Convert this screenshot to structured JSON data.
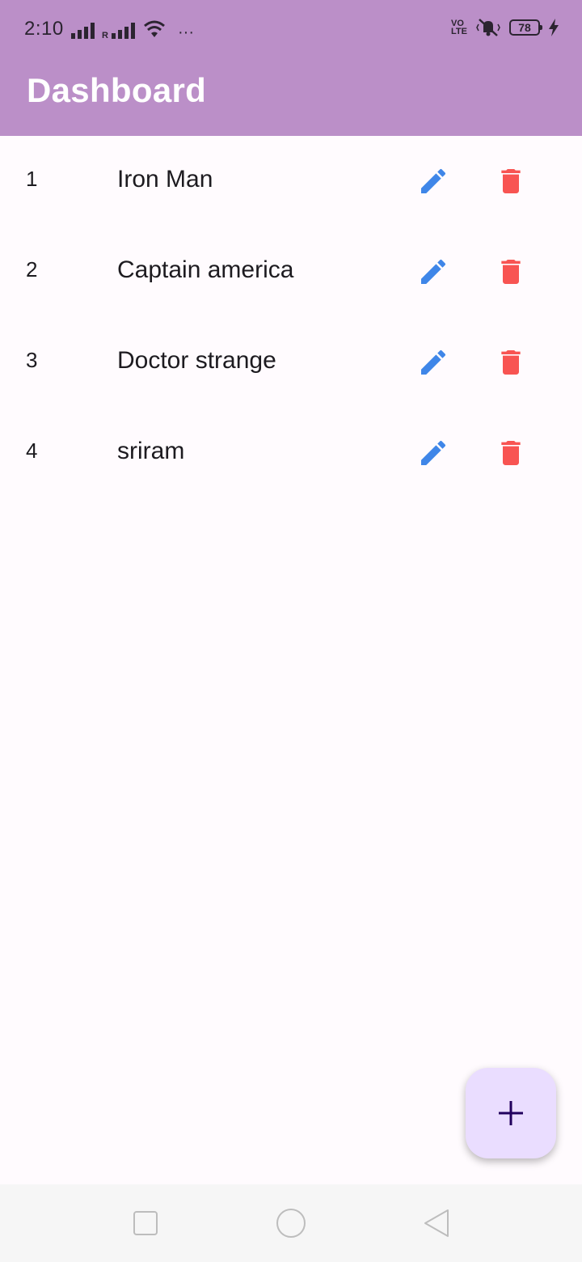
{
  "status_bar": {
    "time": "2:10",
    "more_indicator": "···",
    "volte_line1": "VO",
    "volte_line2": "LTE",
    "battery_level": "78",
    "icons": [
      "signal-icon",
      "signal-roaming-icon",
      "wifi-icon",
      "volte-icon",
      "vibrate-mute-icon",
      "battery-icon",
      "charging-icon"
    ]
  },
  "app_bar": {
    "title": "Dashboard",
    "background": "#bb8fc8"
  },
  "list": {
    "items": [
      {
        "index": "1",
        "name": "Iron Man"
      },
      {
        "index": "2",
        "name": "Captain america"
      },
      {
        "index": "3",
        "name": "Doctor strange"
      },
      {
        "index": "4",
        "name": "sriram"
      }
    ],
    "edit_icon": "pencil-icon",
    "delete_icon": "trash-icon",
    "edit_color": "#3f86e8",
    "delete_color": "#f85452"
  },
  "fab": {
    "icon": "plus-icon",
    "background": "#eaddff"
  },
  "nav_bar": {
    "icons": [
      "recents-square-icon",
      "home-circle-icon",
      "back-triangle-icon"
    ]
  }
}
